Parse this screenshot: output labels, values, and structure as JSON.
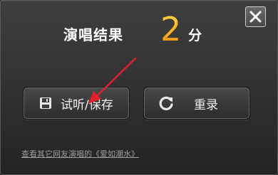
{
  "dialog": {
    "result_title": "演唱结果",
    "score": "2",
    "score_unit": "分"
  },
  "buttons": {
    "save_label": "试听/保存",
    "redo_label": "重录"
  },
  "footer": {
    "link_text": "查看其它网友演唱的《爱如潮水》"
  },
  "icons": {
    "close": "close-icon",
    "save": "floppy-disk-icon",
    "redo": "refresh-icon"
  },
  "colors": {
    "score_gradient_top": "#ffd84a",
    "score_gradient_bottom": "#f28a10",
    "annotation_arrow": "#e0202a"
  }
}
